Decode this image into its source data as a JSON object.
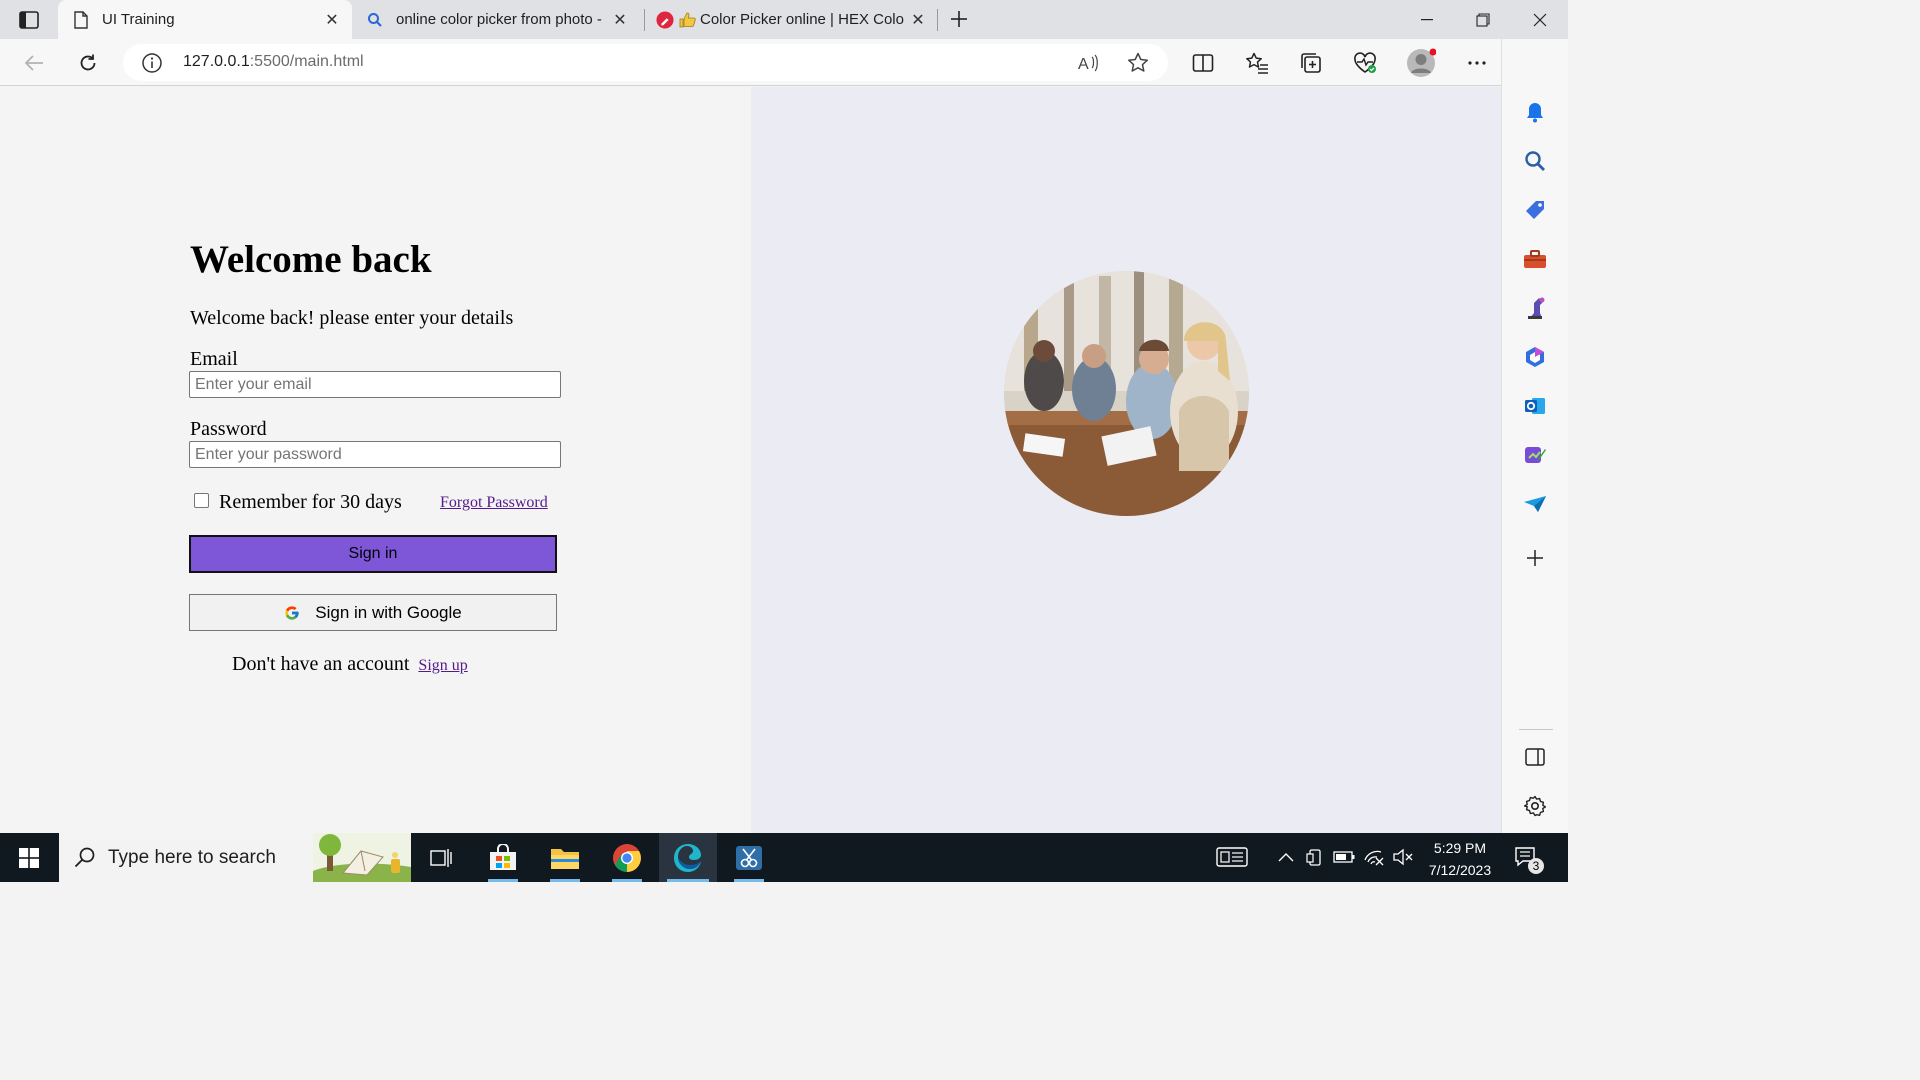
{
  "browser": {
    "tabs": [
      {
        "title": "UI Training",
        "active": true,
        "icon": "page-icon"
      },
      {
        "title": "online color picker from photo -",
        "active": false,
        "icon": "search-icon"
      },
      {
        "title": "Color Picker online | HEX Colo",
        "active": false,
        "icon": "color-picker-icon"
      }
    ],
    "address": {
      "host": "127.0.0.1",
      "rest": ":5500/main.html"
    }
  },
  "login": {
    "title": "Welcome back",
    "subtitle": "Welcome back! please enter your details",
    "email_label": "Email",
    "email_placeholder": "Enter your email",
    "password_label": "Password",
    "password_placeholder": "Enter your password",
    "remember_label": "Remember for 30 days",
    "remember_checked": false,
    "forgot_link": "Forgot Password",
    "signin_button": "Sign in",
    "google_button": "Sign in with Google",
    "no_account_text": "Don't have an account",
    "signup_link": "Sign up"
  },
  "colors": {
    "signin_button_bg": "#7e57d9",
    "right_pane_bg": "#ebebf3",
    "link": "#551a8b"
  },
  "taskbar": {
    "search_placeholder": "Type here to search",
    "time": "5:29 PM",
    "date": "7/12/2023",
    "notification_count": "3"
  }
}
